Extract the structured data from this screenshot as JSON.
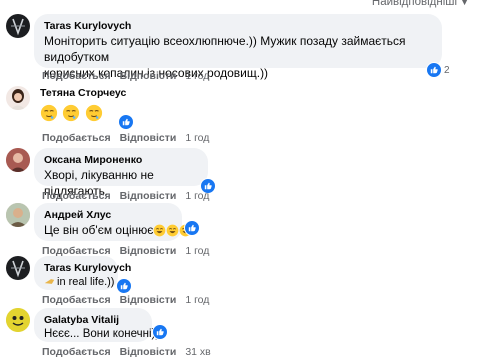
{
  "sort_label": "Найвідповідніші",
  "comments": [
    {
      "author": "Taras Kurylovych",
      "lines": [
        "Моніторить ситуацію всеохлюпнюче.)) Мужик позаду займається видобутком",
        "корисних копалин із носових родовищ.))"
      ],
      "like": "Подобається",
      "reply": "Відповісти",
      "time": "1 год",
      "reactions": "2"
    },
    {
      "author": "Тетяна Сторчеус",
      "emojis": [
        "drooling-face",
        "drooling-face",
        "drooling-face"
      ],
      "like": "Подобається",
      "reply": "Відповісти",
      "time": "1 год"
    },
    {
      "author": "Оксана Мироненко",
      "lines": [
        "Хворі, лікуванню не підлягають."
      ],
      "like": "Подобається",
      "reply": "Відповісти",
      "time": "1 год"
    },
    {
      "author": "Андрей Хлус",
      "text": "Це він об'єм оцінює",
      "emojis": [
        "grinning-face",
        "grinning-face",
        "grinning-face"
      ],
      "like": "Подобається",
      "reply": "Відповісти",
      "time": "1 год"
    },
    {
      "author": "Taras Kurylovych",
      "text": "in real life.))",
      "like": "Подобається",
      "reply": "Відповісти",
      "time": "1 год"
    },
    {
      "author": "Galatyba Vitalij",
      "text": "Нєєє... Вони конечні)))",
      "like": "Подобається",
      "reply": "Відповісти",
      "time": "31 хв"
    }
  ],
  "colors": {
    "bubble": "#f0f2f5",
    "like_blue": "#1877f2",
    "meta_gray": "#65676b"
  }
}
